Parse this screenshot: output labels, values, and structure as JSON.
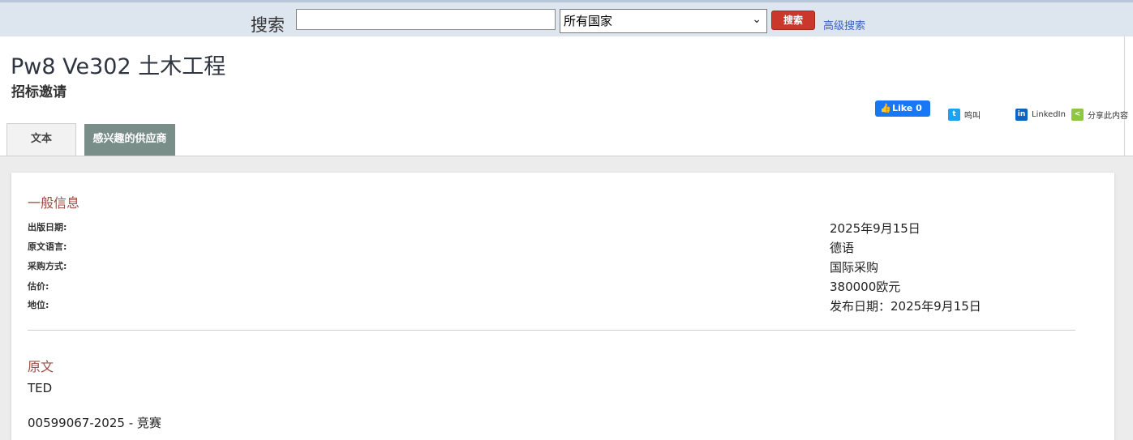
{
  "search": {
    "label": "搜索",
    "input_value": "",
    "country_selected": "所有国家",
    "button_label": "搜索",
    "advanced_link": "高级搜索"
  },
  "header": {
    "title": "Pw8 Ve302 土木工程",
    "subtitle": "招标邀请"
  },
  "social": {
    "facebook_like": "Like 0",
    "twitter": "鸣叫",
    "linkedin": "LinkedIn",
    "share": "分享此内容"
  },
  "tabs": [
    {
      "label": "文本",
      "active": true
    },
    {
      "label": "感兴趣的供应商",
      "active": false
    }
  ],
  "general_info": {
    "title": "一般信息",
    "rows": [
      {
        "label": "出版日期:",
        "value": "2025年9月15日"
      },
      {
        "label": "原文语言:",
        "value": "德语"
      },
      {
        "label": "采购方式:",
        "value": "国际采购"
      },
      {
        "label": "估价:",
        "value": "380000欧元"
      },
      {
        "label": "地位:",
        "value": "发布日期：2025年9月15日"
      }
    ]
  },
  "original_text": {
    "title": "原文",
    "source": "TED",
    "reference": "00599067-2025 - 竞赛"
  },
  "colors": {
    "search_button": "#c9382a",
    "section_title": "#9b4e43",
    "inactive_tab": "#7a8e89",
    "facebook": "#1877f2"
  }
}
